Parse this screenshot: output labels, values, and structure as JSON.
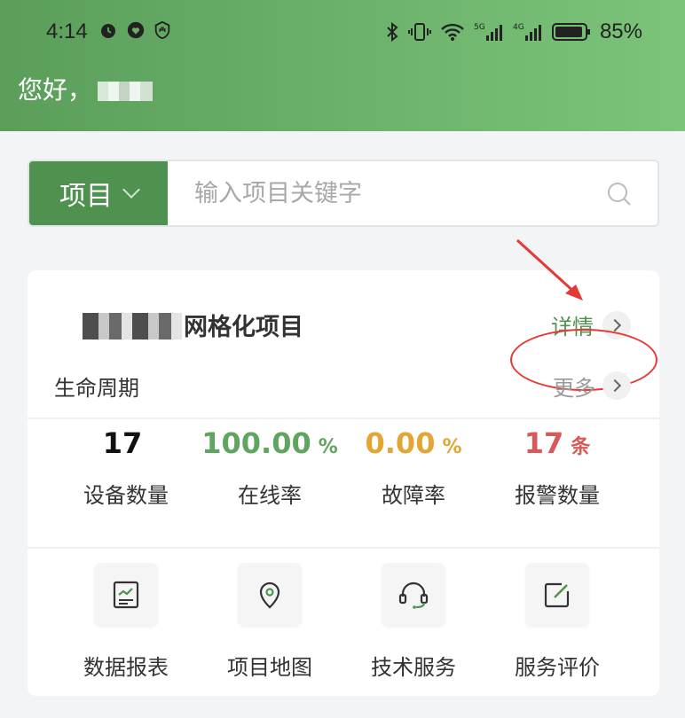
{
  "status_bar": {
    "time": "4:14",
    "battery": "85%"
  },
  "greeting": "您好，",
  "search": {
    "selector_label": "项目",
    "placeholder": "输入项目关键字"
  },
  "project": {
    "name_suffix": "网格化项目",
    "detail_label": "详情",
    "lifecycle_label": "生命周期",
    "more_label": "更多"
  },
  "stats": [
    {
      "value": "17",
      "unit": "",
      "label": "设备数量",
      "color": "#111111"
    },
    {
      "value": "100.00",
      "unit": "%",
      "label": "在线率",
      "color": "#5fa45f"
    },
    {
      "value": "0.00",
      "unit": "%",
      "label": "故障率",
      "color": "#e3a534"
    },
    {
      "value": "17",
      "unit": "条",
      "label": "报警数量",
      "color": "#d65a5a"
    }
  ],
  "actions": [
    {
      "label": "数据报表",
      "icon": "report-icon"
    },
    {
      "label": "项目地图",
      "icon": "map-pin-icon"
    },
    {
      "label": "技术服务",
      "icon": "headset-icon"
    },
    {
      "label": "服务评价",
      "icon": "edit-icon"
    }
  ],
  "colors": {
    "accent": "#4f914f",
    "annotation": "#e53935"
  }
}
